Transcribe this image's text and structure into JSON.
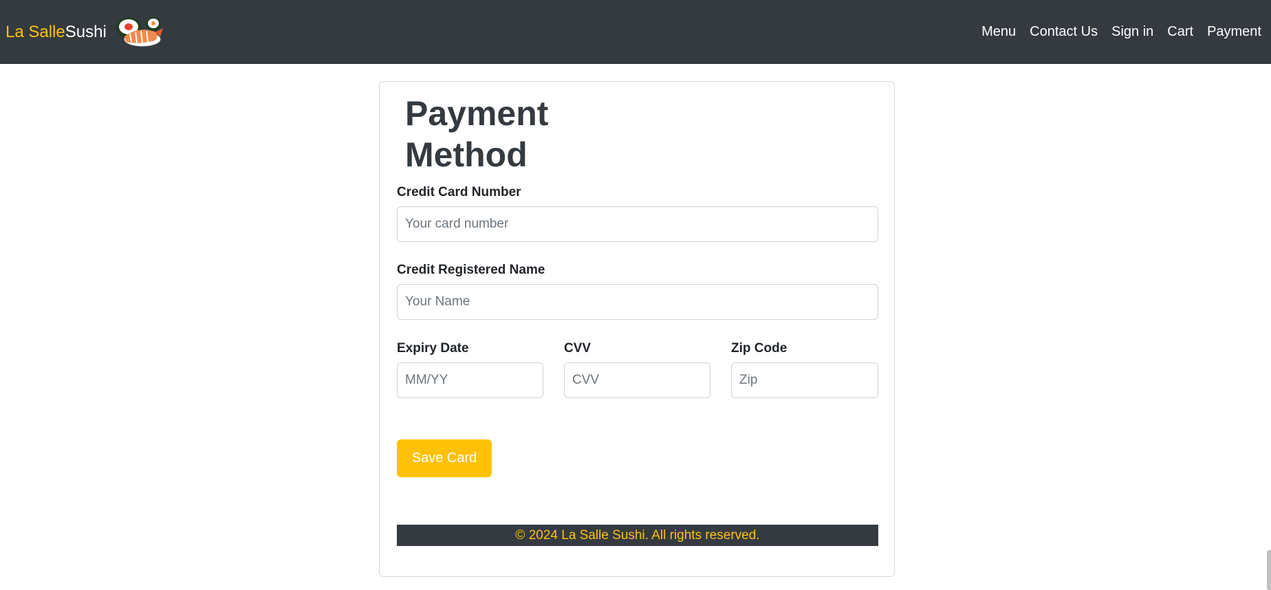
{
  "navbar": {
    "brand_part_1": "La Salle",
    "brand_part_2": "Sushi",
    "logo_icon": "sushi-icon",
    "links": [
      "Menu",
      "Contact Us",
      "Sign in",
      "Cart",
      "Payment"
    ]
  },
  "form": {
    "title": "Payment Method",
    "card_number": {
      "label": "Credit Card Number",
      "placeholder": "Your card number",
      "value": ""
    },
    "card_name": {
      "label": "Credit Registered Name",
      "placeholder": "Your Name",
      "value": ""
    },
    "expiry": {
      "label": "Expiry Date",
      "placeholder": "MM/YY",
      "value": ""
    },
    "cvv": {
      "label": "CVV",
      "placeholder": "CVV",
      "value": ""
    },
    "zip": {
      "label": "Zip Code",
      "placeholder": "Zip",
      "value": ""
    },
    "save_label": "Save Card"
  },
  "footer": {
    "text": "© 2024 La Salle Sushi. All rights reserved."
  },
  "colors": {
    "navbar_bg": "#343a40",
    "accent": "#ffc107",
    "text": "#212529"
  }
}
